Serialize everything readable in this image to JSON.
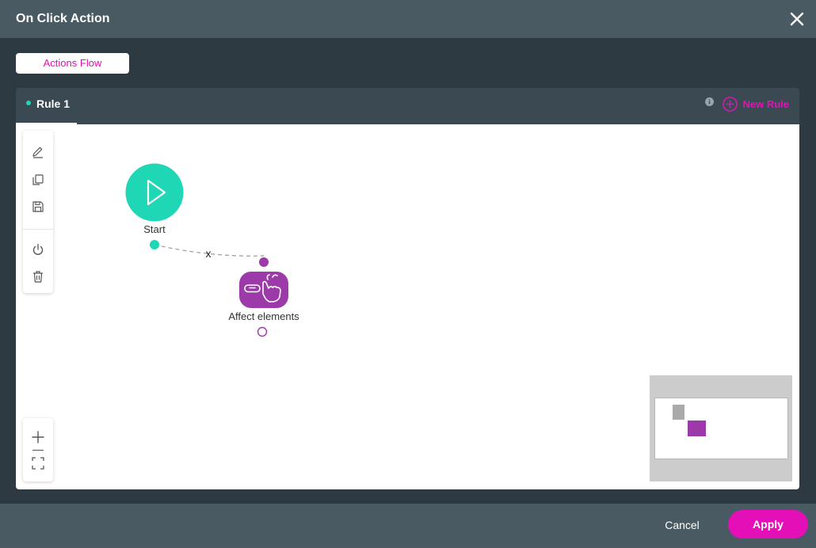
{
  "dialog": {
    "title": "On Click Action",
    "close_icon": "close-icon"
  },
  "tabs": {
    "active_label": "Actions Flow"
  },
  "rules": {
    "active_rule_label": "Rule 1",
    "new_rule_label": "New Rule",
    "info_icon": "info-icon"
  },
  "toolbar": {
    "tools": [
      "edit-icon",
      "duplicate-icon",
      "save-icon",
      "power-icon",
      "trash-icon"
    ],
    "zoom": [
      "zoom-in-icon",
      "fit-view-icon"
    ]
  },
  "flow": {
    "start_label": "Start",
    "connector_label": "x",
    "action_label": "Affect elements"
  },
  "footer": {
    "cancel_label": "Cancel",
    "apply_label": "Apply"
  },
  "colors": {
    "accent": "#e50fb8",
    "start_node": "#1fd6b5",
    "action_node": "#9b3aa8",
    "header": "#4a5a63",
    "background": "#2e3a42"
  }
}
